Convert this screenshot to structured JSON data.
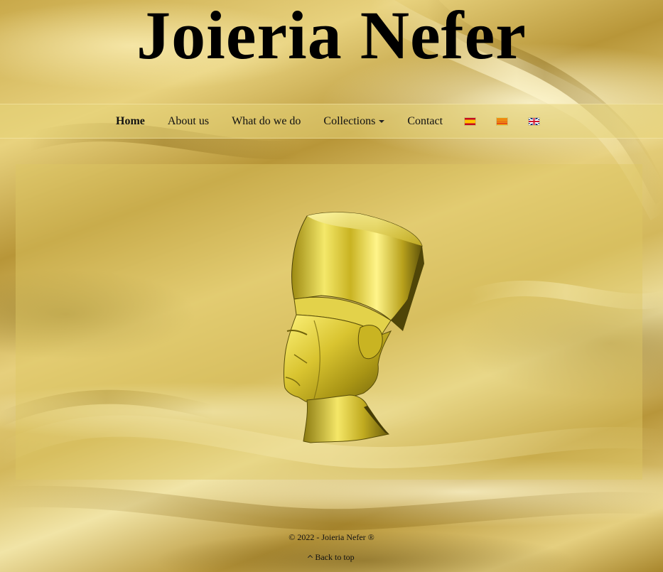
{
  "site": {
    "title": "Joieria Nefer"
  },
  "nav": {
    "items": [
      {
        "label": "Home",
        "active": true
      },
      {
        "label": "About us",
        "active": false
      },
      {
        "label": "What do we do",
        "active": false
      },
      {
        "label": "Collections",
        "active": false,
        "dropdown": true
      },
      {
        "label": "Contact",
        "active": false
      }
    ],
    "languages": [
      {
        "code": "es",
        "icon": "spain-flag-icon"
      },
      {
        "code": "ca",
        "icon": "catalonia-flag-icon"
      },
      {
        "code": "en",
        "icon": "uk-flag-icon"
      }
    ]
  },
  "main": {
    "image": "golden-nefertiti-bust"
  },
  "footer": {
    "copyright": "© 2022 - Joieria Nefer ®",
    "back_to_top": "Back to top"
  },
  "colors": {
    "background_gold": "#d6bb5e",
    "navbar": "#e6d478",
    "text": "#111111"
  }
}
